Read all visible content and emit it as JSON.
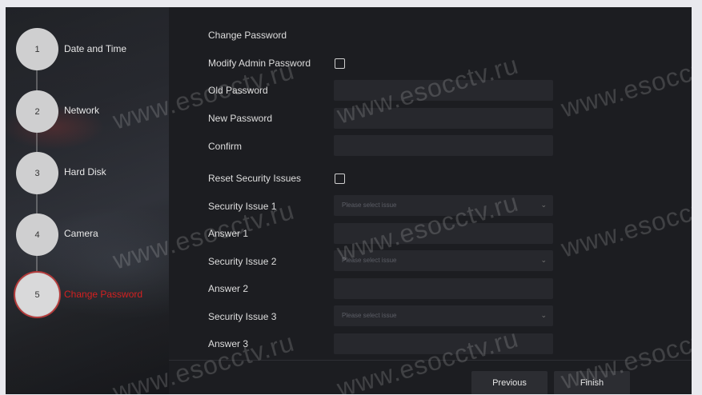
{
  "steps": [
    {
      "num": "1",
      "label": "Date and Time"
    },
    {
      "num": "2",
      "label": "Network"
    },
    {
      "num": "3",
      "label": "Hard Disk"
    },
    {
      "num": "4",
      "label": "Camera"
    },
    {
      "num": "5",
      "label": "Change Password"
    }
  ],
  "form": {
    "section_title": "Change Password",
    "modify_admin_label": "Modify Admin Password",
    "old_password_label": "Old Password",
    "new_password_label": "New Password",
    "confirm_label": "Confirm",
    "reset_security_label": "Reset Security Issues",
    "security_issue_1_label": "Security Issue 1",
    "answer_1_label": "Answer 1",
    "security_issue_2_label": "Security Issue 2",
    "answer_2_label": "Answer 2",
    "security_issue_3_label": "Security Issue 3",
    "answer_3_label": "Answer 3",
    "select_placeholder": "Please select issue"
  },
  "footer": {
    "previous_label": "Previous",
    "finish_label": "Finish"
  },
  "watermark": "www.esocctv.ru",
  "colors": {
    "active_step": "#d42020",
    "panel_bg": "#1c1d21",
    "field_bg": "#27282d"
  }
}
